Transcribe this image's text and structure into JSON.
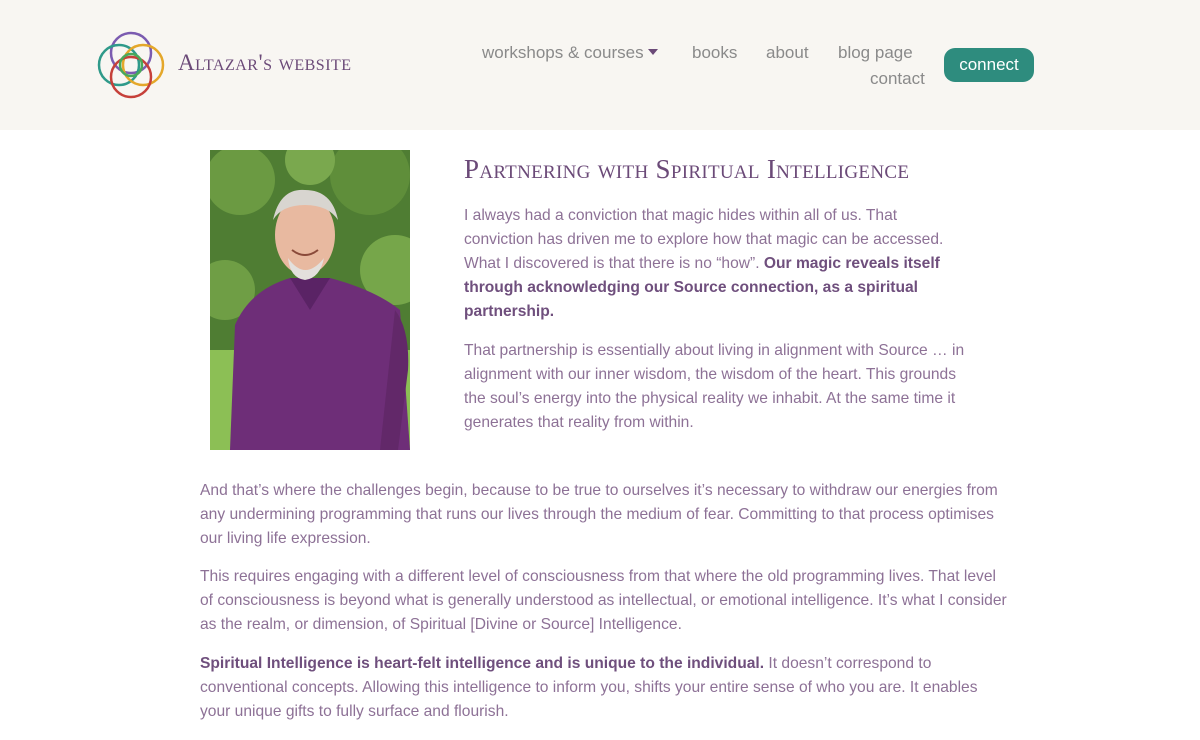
{
  "header": {
    "site_title": "Altazar's website",
    "nav": {
      "workshops": "workshops & courses",
      "books": "books",
      "about": "about",
      "blog": "blog page",
      "contact": "contact",
      "connect": "connect"
    }
  },
  "article": {
    "title": "Partnering with Spiritual Intelligence",
    "p1_plain": "I always had a conviction that magic hides within all of us. That conviction has driven me to explore how that magic can be accessed. What I discovered is that there is no “how”. ",
    "p1_bold": "Our magic reveals itself through acknowledging our Source connection, as a spiritual partnership.",
    "p2": "That partnership is essentially about living in alignment with Source … in alignment with our inner wisdom, the wisdom of the heart. This grounds the soul’s energy into the physical reality we inhabit. At the same time it generates that reality from within.",
    "p3": "And that’s where the challenges begin, because to be true to ourselves it’s necessary to withdraw our energies from any undermining programming that runs our lives through the medium of fear. Committing to that process optimises our living life expression.",
    "p4": "This requires engaging with a different level of consciousness from that where the old programming lives. That level of consciousness is beyond what is generally understood as intellectual, or emotional intelligence. It’s what I consider as the realm, or dimension, of Spiritual [Divine or Source] Intelligence.",
    "p5_bold": "Spiritual Intelligence is heart-felt intelligence and is unique to the individual.",
    "p5_plain": " It doesn’t correspond to conventional concepts. Allowing this intelligence to inform you, shifts your entire sense of who you are. It enables your unique gifts to fully surface and flourish."
  },
  "colors": {
    "header_bg": "#f8f6f2",
    "accent_purple": "#6b4a78",
    "button_teal": "#2e8c7e",
    "nav_gray": "#8a8a8a"
  },
  "icons": {
    "logo": "interlocking-rainbow-circles-logo",
    "caret": "caret-down-icon"
  }
}
